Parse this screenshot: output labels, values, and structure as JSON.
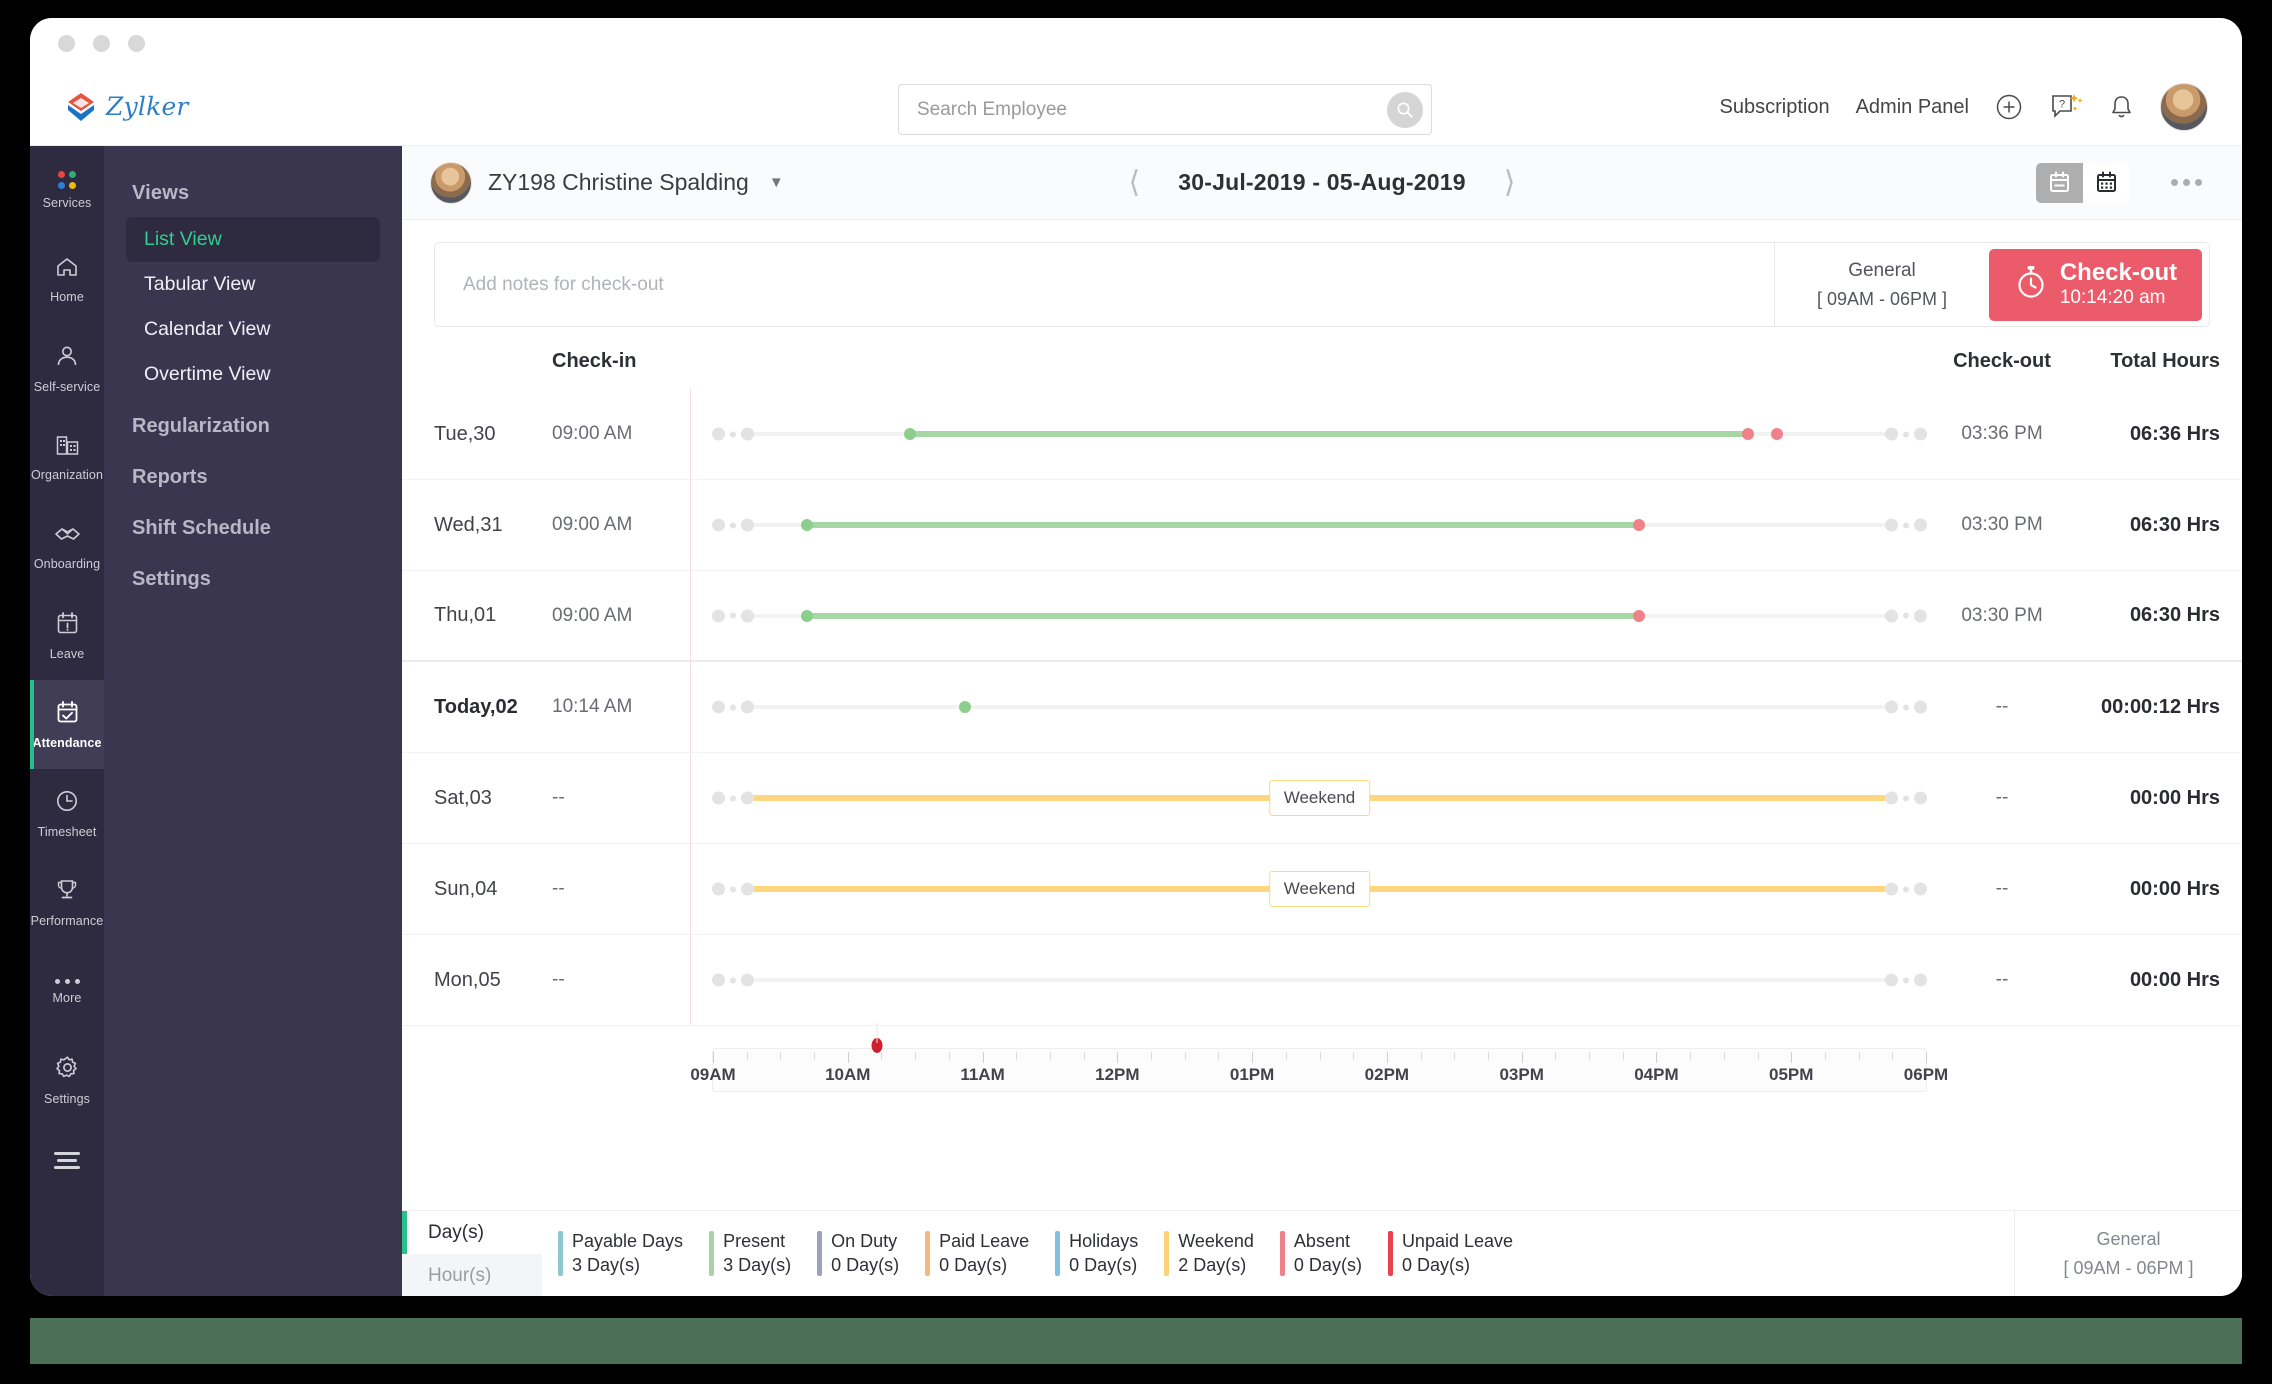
{
  "brand": {
    "name": "Zylker"
  },
  "search": {
    "placeholder": "Search Employee",
    "value": "",
    "icon": "search-icon"
  },
  "topbar": {
    "subscription": "Subscription",
    "admin_panel": "Admin Panel",
    "add_icon": "plus-circle-icon",
    "help_icon": "help-chat-icon",
    "bell_icon": "bell-icon",
    "avatar": "user-avatar"
  },
  "rail": {
    "items": [
      {
        "label": "Services",
        "icon": "apps-dots-icon",
        "active": false
      },
      {
        "label": "Home",
        "icon": "home-icon",
        "active": false
      },
      {
        "label": "Self-service",
        "icon": "person-icon",
        "active": false
      },
      {
        "label": "Organization",
        "icon": "building-icon",
        "active": false
      },
      {
        "label": "Onboarding",
        "icon": "handshake-icon",
        "active": false
      },
      {
        "label": "Leave",
        "icon": "calendar-alert-icon",
        "active": false
      },
      {
        "label": "Attendance",
        "icon": "calendar-check-icon",
        "active": true
      },
      {
        "label": "Timesheet",
        "icon": "clock-icon",
        "active": false
      },
      {
        "label": "Performance",
        "icon": "trophy-icon",
        "active": false
      },
      {
        "label": "More",
        "icon": "ellipsis-icon",
        "active": false
      }
    ],
    "settings": {
      "label": "Settings",
      "icon": "gear-icon"
    },
    "collapse": {
      "icon": "hamburger-icon"
    }
  },
  "nav": {
    "views_header": "Views",
    "views": [
      {
        "label": "List View",
        "active": true
      },
      {
        "label": "Tabular View",
        "active": false
      },
      {
        "label": "Calendar View",
        "active": false
      },
      {
        "label": "Overtime View",
        "active": false
      }
    ],
    "sections": [
      {
        "label": "Regularization"
      },
      {
        "label": "Reports"
      },
      {
        "label": "Shift Schedule"
      },
      {
        "label": "Settings"
      }
    ]
  },
  "employee": {
    "name": "ZY198 Christine Spalding",
    "caret": "chevron-down-icon"
  },
  "daterange": {
    "text": "30-Jul-2019  -  05-Aug-2019",
    "prev": "chevron-left-icon",
    "next": "chevron-right-icon"
  },
  "view_toggle": {
    "list_icon": "list-view-icon",
    "grid_icon": "calendar-grid-icon",
    "active": "list"
  },
  "more_menu": {
    "icon": "kebab-menu-icon"
  },
  "checkout": {
    "notes_placeholder": "Add notes for check-out",
    "notes_value": "",
    "shift_name": "General",
    "shift_time": "[ 09AM - 06PM ]",
    "button_label": "Check-out",
    "button_time": "10:14:20 am",
    "button_icon": "stopwatch-icon",
    "button_color": "#ec5b6a"
  },
  "table": {
    "headers": {
      "day": "",
      "checkin": "Check-in",
      "checkout": "Check-out",
      "total": "Total Hours"
    },
    "rows": [
      {
        "day": "Tue,30",
        "checkin": "09:00 AM",
        "checkout": "03:36 PM",
        "total": "06:36 Hrs",
        "type": "present",
        "today": false,
        "seg_start_pct": 13.0,
        "seg_end_pct": 82.0,
        "points": [
          {
            "pct": 13.0,
            "color": "green"
          },
          {
            "pct": 82.0,
            "color": "red"
          },
          {
            "pct": 84.4,
            "color": "red"
          }
        ]
      },
      {
        "day": "Wed,31",
        "checkin": "09:00 AM",
        "checkout": "03:30 PM",
        "total": "06:30 Hrs",
        "type": "present",
        "today": false,
        "seg_start_pct": 4.5,
        "seg_end_pct": 73.0,
        "points": [
          {
            "pct": 4.5,
            "color": "green"
          },
          {
            "pct": 73.0,
            "color": "red"
          }
        ]
      },
      {
        "day": "Thu,01",
        "checkin": "09:00 AM",
        "checkout": "03:30 PM",
        "total": "06:30 Hrs",
        "type": "present",
        "today": false,
        "seg_start_pct": 4.5,
        "seg_end_pct": 73.0,
        "points": [
          {
            "pct": 4.5,
            "color": "green"
          },
          {
            "pct": 73.0,
            "color": "red"
          }
        ]
      },
      {
        "day": "Today,02",
        "checkin": "10:14 AM",
        "checkout": "--",
        "total": "00:00:12 Hrs",
        "type": "today",
        "today": true,
        "seg_start_pct": 0,
        "seg_end_pct": 0,
        "points": [
          {
            "pct": 17.5,
            "color": "green"
          }
        ]
      },
      {
        "day": "Sat,03",
        "checkin": "--",
        "checkout": "--",
        "total": "00:00 Hrs",
        "type": "weekend",
        "today": false,
        "weekend_label": "Weekend",
        "seg_start_pct": 0,
        "seg_end_pct": 100,
        "points": []
      },
      {
        "day": "Sun,04",
        "checkin": "--",
        "checkout": "--",
        "total": "00:00 Hrs",
        "type": "weekend",
        "today": false,
        "weekend_label": "Weekend",
        "seg_start_pct": 0,
        "seg_end_pct": 100,
        "points": []
      },
      {
        "day": "Mon,05",
        "checkin": "--",
        "checkout": "--",
        "total": "00:00 Hrs",
        "type": "empty",
        "today": false,
        "seg_start_pct": 0,
        "seg_end_pct": 0,
        "points": []
      }
    ]
  },
  "axis": {
    "labels": [
      "09AM",
      "10AM",
      "11AM",
      "12PM",
      "01PM",
      "02PM",
      "03PM",
      "04PM",
      "05PM",
      "06PM"
    ],
    "now_pct": 13.5
  },
  "footer": {
    "units": [
      {
        "label": "Day(s)",
        "active": true
      },
      {
        "label": "Hour(s)",
        "active": false
      }
    ],
    "legend": [
      {
        "name": "Payable Days",
        "value": "3 Day(s)",
        "color": "#8fc6cf"
      },
      {
        "name": "Present",
        "value": "3 Day(s)",
        "color": "#a8d3a4"
      },
      {
        "name": "On Duty",
        "value": "0 Day(s)",
        "color": "#9aa3bb"
      },
      {
        "name": "Paid Leave",
        "value": "0 Day(s)",
        "color": "#f6b87c"
      },
      {
        "name": "Holidays",
        "value": "0 Day(s)",
        "color": "#7fc0e0"
      },
      {
        "name": "Weekend",
        "value": "2 Day(s)",
        "color": "#fbd27a"
      },
      {
        "name": "Absent",
        "value": "0 Day(s)",
        "color": "#ef8289"
      },
      {
        "name": "Unpaid Leave",
        "value": "0 Day(s)",
        "color": "#e8414f"
      }
    ],
    "shift_name": "General",
    "shift_time": "[ 09AM - 06PM ]"
  },
  "colors": {
    "rail_bg": "#2e2b40",
    "nav_bg": "#3a3650",
    "accent_teal": "#28c08d",
    "accent_red": "#ec5b6a",
    "present_green": "#a7d7a7",
    "weekend_yellow": "#fcd77f",
    "bottom_strip": "#4a7155"
  }
}
